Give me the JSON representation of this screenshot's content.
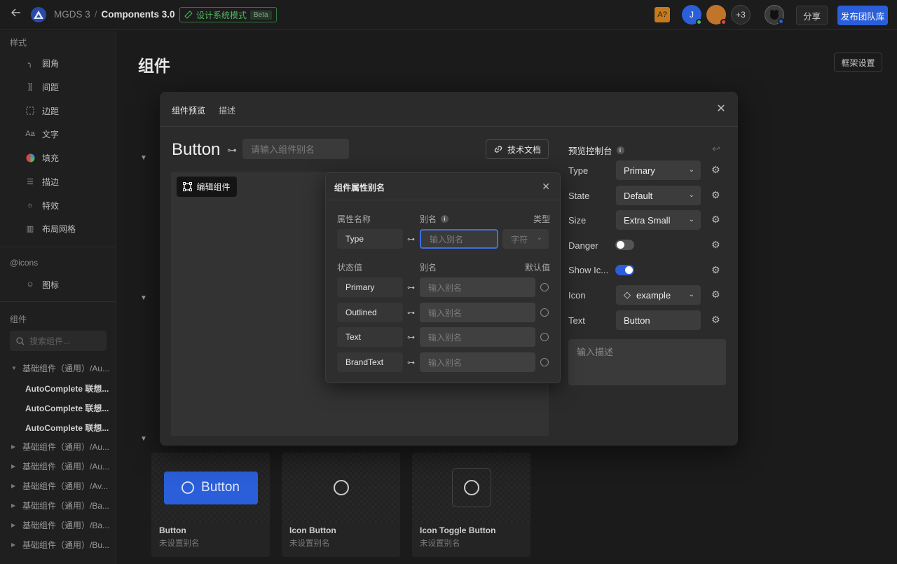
{
  "topbar": {
    "back_icon": "arrow-left-icon",
    "project": "MGDS 3",
    "separator": "/",
    "file": "Components 3.0",
    "mode_label": "设计系统模式",
    "beta": "Beta",
    "avatar_a": "A?",
    "avatar_j": "J",
    "avatar_more": "+3",
    "share": "分享",
    "publish": "发布团队库",
    "colors": {
      "accent": "#2b5fd9",
      "green": "#4dbb5d",
      "orange": "#c77a1b"
    }
  },
  "sidebar": {
    "style_heading": "样式",
    "style_items": [
      {
        "label": "圆角",
        "icon": "corner-radius-icon"
      },
      {
        "label": "间距",
        "icon": "spacing-icon"
      },
      {
        "label": "边距",
        "icon": "padding-icon"
      },
      {
        "label": "文字",
        "icon": "text-icon"
      },
      {
        "label": "填充",
        "icon": "fill-icon"
      },
      {
        "label": "描边",
        "icon": "stroke-icon"
      },
      {
        "label": "特效",
        "icon": "effect-icon"
      },
      {
        "label": "布局网格",
        "icon": "layout-grid-icon"
      }
    ],
    "icons_heading": "@icons",
    "icons_item": "图标",
    "components_heading": "组件",
    "search_placeholder": "搜索组件...",
    "tree": [
      {
        "label": "基础组件（通用）/Au...",
        "expanded": true
      },
      {
        "label": "AutoComplete 联想..."
      },
      {
        "label": "AutoComplete 联想..."
      },
      {
        "label": "AutoComplete 联想..."
      },
      {
        "label": "基础组件（通用）/Au...",
        "expanded": false
      },
      {
        "label": "基础组件（通用）/Au...",
        "expanded": false
      },
      {
        "label": "基础组件（通用）/Av...",
        "expanded": false
      },
      {
        "label": "基础组件（通用）/Ba...",
        "expanded": false
      },
      {
        "label": "基础组件（通用）/Ba...",
        "expanded": false
      },
      {
        "label": "基础组件（通用）/Bu...",
        "expanded": false
      }
    ]
  },
  "main": {
    "title": "组件",
    "frame_settings": "框架设置",
    "cards": [
      {
        "name": "Button",
        "alias": "未设置别名",
        "preview_label": "Button"
      },
      {
        "name": "Icon Button",
        "alias": "未设置别名"
      },
      {
        "name": "Icon Toggle Button",
        "alias": "未设置别名"
      }
    ]
  },
  "modal": {
    "tabs": [
      {
        "label": "组件预览",
        "active": true
      },
      {
        "label": "描述",
        "active": false
      }
    ],
    "component_name": "Button",
    "link_symbol": "⊶",
    "alias_placeholder": "请输入组件别名",
    "doc_button": "技术文档",
    "edit_button": "编辑组件",
    "control_title": "预览控制台",
    "controls": [
      {
        "label": "Type",
        "kind": "select",
        "value": "Primary"
      },
      {
        "label": "State",
        "kind": "select",
        "value": "Default"
      },
      {
        "label": "Size",
        "kind": "select",
        "value": "Extra Small"
      },
      {
        "label": "Danger",
        "kind": "toggle",
        "value": false
      },
      {
        "label": "Show Ic...",
        "kind": "toggle",
        "value": true
      },
      {
        "label": "Icon",
        "kind": "select",
        "value": "example"
      },
      {
        "label": "Text",
        "kind": "input",
        "value": "Button"
      }
    ],
    "desc_placeholder": "输入描述"
  },
  "alias_popup": {
    "title": "组件属性别名",
    "hd_prop": "属性名称",
    "hd_alias": "别名",
    "hd_type": "类型",
    "prop_name": "Type",
    "prop_alias_placeholder": "输入别名",
    "prop_type": "字符",
    "hd_state": "状态值",
    "hd_alias2": "别名",
    "hd_default": "默认值",
    "states": [
      {
        "name": "Primary",
        "placeholder": "输入别名"
      },
      {
        "name": "Outlined",
        "placeholder": "输入别名"
      },
      {
        "name": "Text",
        "placeholder": "输入别名"
      },
      {
        "name": "BrandText",
        "placeholder": "输入别名"
      }
    ]
  }
}
